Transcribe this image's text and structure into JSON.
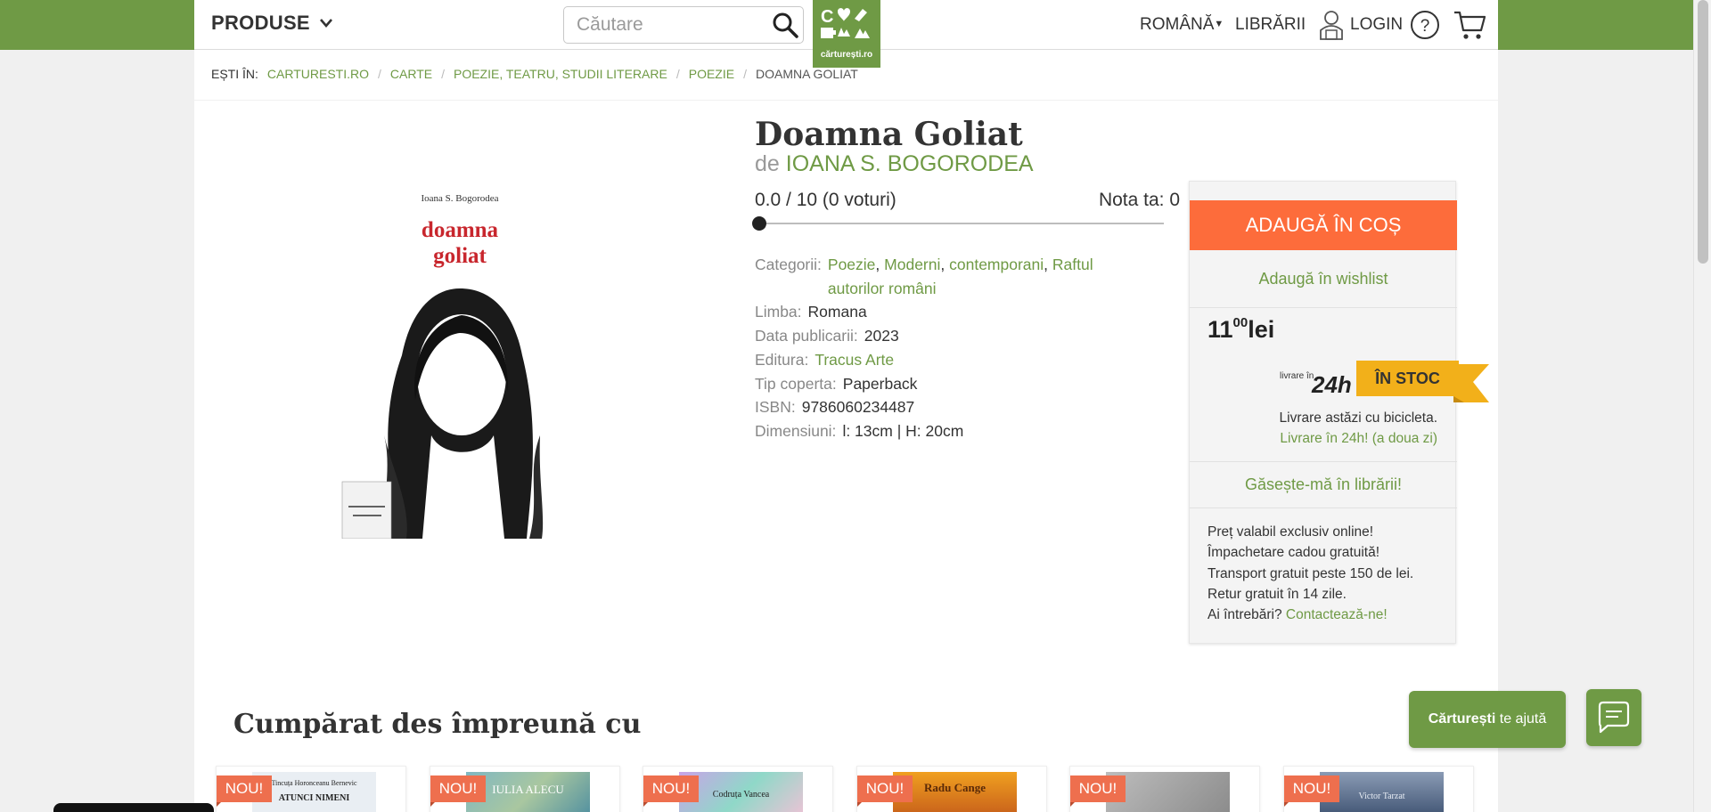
{
  "header": {
    "products_label": "PRODUSE",
    "search_placeholder": "Căutare",
    "logo_text": "cărturești.ro",
    "language": "ROMÂNĂ",
    "stores": "LIBRĂRII",
    "login": "LOGIN"
  },
  "breadcrumb": {
    "prefix": "EȘTI ÎN:",
    "items": [
      "CARTURESTI.RO",
      "CARTE",
      "POEZIE, TEATRU, STUDII LITERARE",
      "POEZIE"
    ],
    "current": "DOAMNA GOLIAT"
  },
  "book": {
    "cover_author": "Ioana S. Bogorodea",
    "cover_title_line1": "doamna",
    "cover_title_line2": "goliat",
    "title": "Doamna Goliat",
    "by": "de",
    "author": "IOANA S. BOGORODEA",
    "rating": "0.0 / 10 (0 voturi)",
    "your_rating": "Nota ta: 0",
    "details": {
      "categories_label": "Categorii:",
      "categories": [
        "Poezie",
        "Moderni",
        "contemporani",
        "Raftul autorilor români"
      ],
      "language_label": "Limba:",
      "language": "Romana",
      "date_label": "Data publicarii:",
      "date": "2023",
      "publisher_label": "Editura:",
      "publisher": "Tracus Arte",
      "cover_label": "Tip coperta:",
      "cover": "Paperback",
      "isbn_label": "ISBN:",
      "isbn": "9786060234487",
      "size_label": "Dimensiuni:",
      "size": "l: 13cm | H: 20cm"
    }
  },
  "buybox": {
    "add_to_cart": "ADAUGĂ ÎN COȘ",
    "wishlist": "Adaugă în wishlist",
    "price_int": "11",
    "price_dec": "00",
    "currency": "lei",
    "livrare_small": "livrare în",
    "livrare_big": "24h",
    "stock": "ÎN STOC",
    "delivery_line1": "Livrare astăzi cu bicicleta.",
    "delivery_line2": "Livrare în 24h! (a doua zi)",
    "find_in_stores": "Găsește-mă în librării!",
    "perks": [
      "Preț valabil exclusiv online!",
      "Împachetare cadou gratuită!",
      "Transport gratuit peste 150 de lei.",
      "Retur gratuit în 14 zile."
    ],
    "questions": "Ai întrebări?",
    "contact": "Contactează-ne!"
  },
  "together": {
    "title": "Cumpărat des împreună cu",
    "badge": "NOU!",
    "cards": [
      {
        "cover_top": "Tincuța Horonceanu Bernevic",
        "cover_title": "ATUNCI NIMENI"
      },
      {
        "cover_top": "",
        "cover_title": "IULIA ALECU"
      },
      {
        "cover_top": "",
        "cover_title": "Codruța Vancea"
      },
      {
        "cover_top": "",
        "cover_title": "Radu Cange"
      },
      {
        "cover_top": "",
        "cover_title": ""
      },
      {
        "cover_top": "",
        "cover_title": "Victor Tarzat"
      }
    ]
  },
  "helpbar": {
    "brand": "Cărturești",
    "text": "te ajută"
  },
  "colors": {
    "brand_green": "#6f9a45",
    "cart_orange": "#fd6c3b",
    "stock_yellow": "#f2b01a",
    "badge_red": "#ee6f4e"
  }
}
